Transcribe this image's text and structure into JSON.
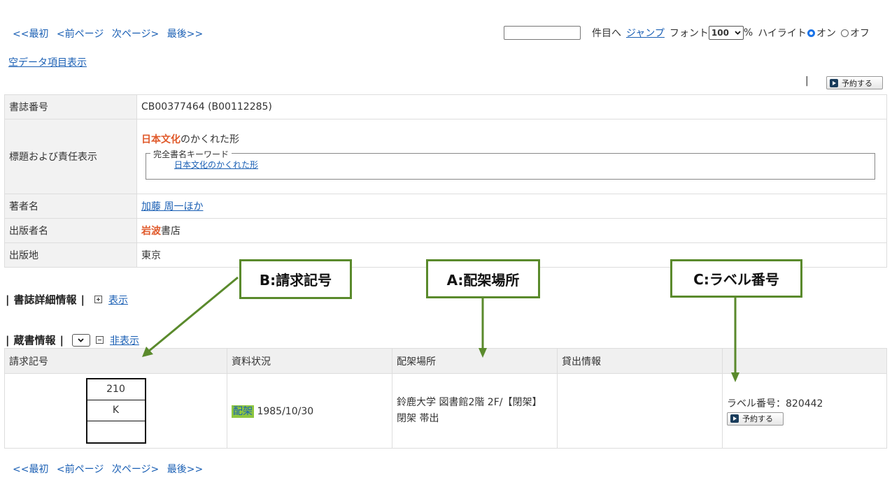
{
  "nav": {
    "first": "<<最初",
    "prev": "<前ページ",
    "next": "次ページ>",
    "last": "最後>>"
  },
  "toolbar": {
    "jump_input_value": "",
    "item_suffix": "件目へ",
    "jump_label": "ジャンプ",
    "font_label": "フォント",
    "font_value": "100",
    "percent": "%",
    "highlight_label": "ハイライト",
    "on_label": "オン",
    "off_label": "オフ",
    "highlight_selected": "on"
  },
  "empty_data_link": "空データ項目表示",
  "reserve_label": "予約する",
  "separator": "|",
  "biblio": {
    "rows": [
      {
        "label": "書誌番号",
        "value": "CB00377464 (B00112285)"
      },
      {
        "label": "標題および責任表示",
        "title_highlight": "日本文化",
        "title_rest": "のかくれた形",
        "keyword_legend": "完全書名キーワード",
        "keyword": "日本文化のかくれた形"
      },
      {
        "label": "著者名",
        "value": "加藤 周一ほか"
      },
      {
        "label": "出版者名",
        "value_highlight": "岩波",
        "value_rest": "書店"
      },
      {
        "label": "出版地",
        "value": "東京"
      }
    ]
  },
  "sections": {
    "detail": {
      "title": "書誌詳細情報",
      "toggle": "表示"
    },
    "holdings": {
      "title": "蔵書情報",
      "toggle": "非表示"
    }
  },
  "holdings": {
    "headers": [
      "請求記号",
      "資料状況",
      "配架場所",
      "貸出情報",
      ""
    ],
    "row": {
      "call_number": [
        "210",
        "K",
        ""
      ],
      "status_badge": "配架",
      "status_date": "1985/10/30",
      "location_line1": "鈴鹿大学 図書館2階 2F/【閉架】",
      "location_line2": "閉架 帯出",
      "loan_info": "",
      "label_number": "ラベル番号：820442"
    }
  },
  "annotations": {
    "b": "B:請求記号",
    "a": "A:配架場所",
    "c": "C:ラベル番号",
    "color": "#5a8a2c"
  },
  "colors": {
    "link": "#1a5fb4",
    "highlight": "#e05a2b",
    "status_badge": "#8dc63f",
    "header_bg": "#f0f0f0"
  }
}
